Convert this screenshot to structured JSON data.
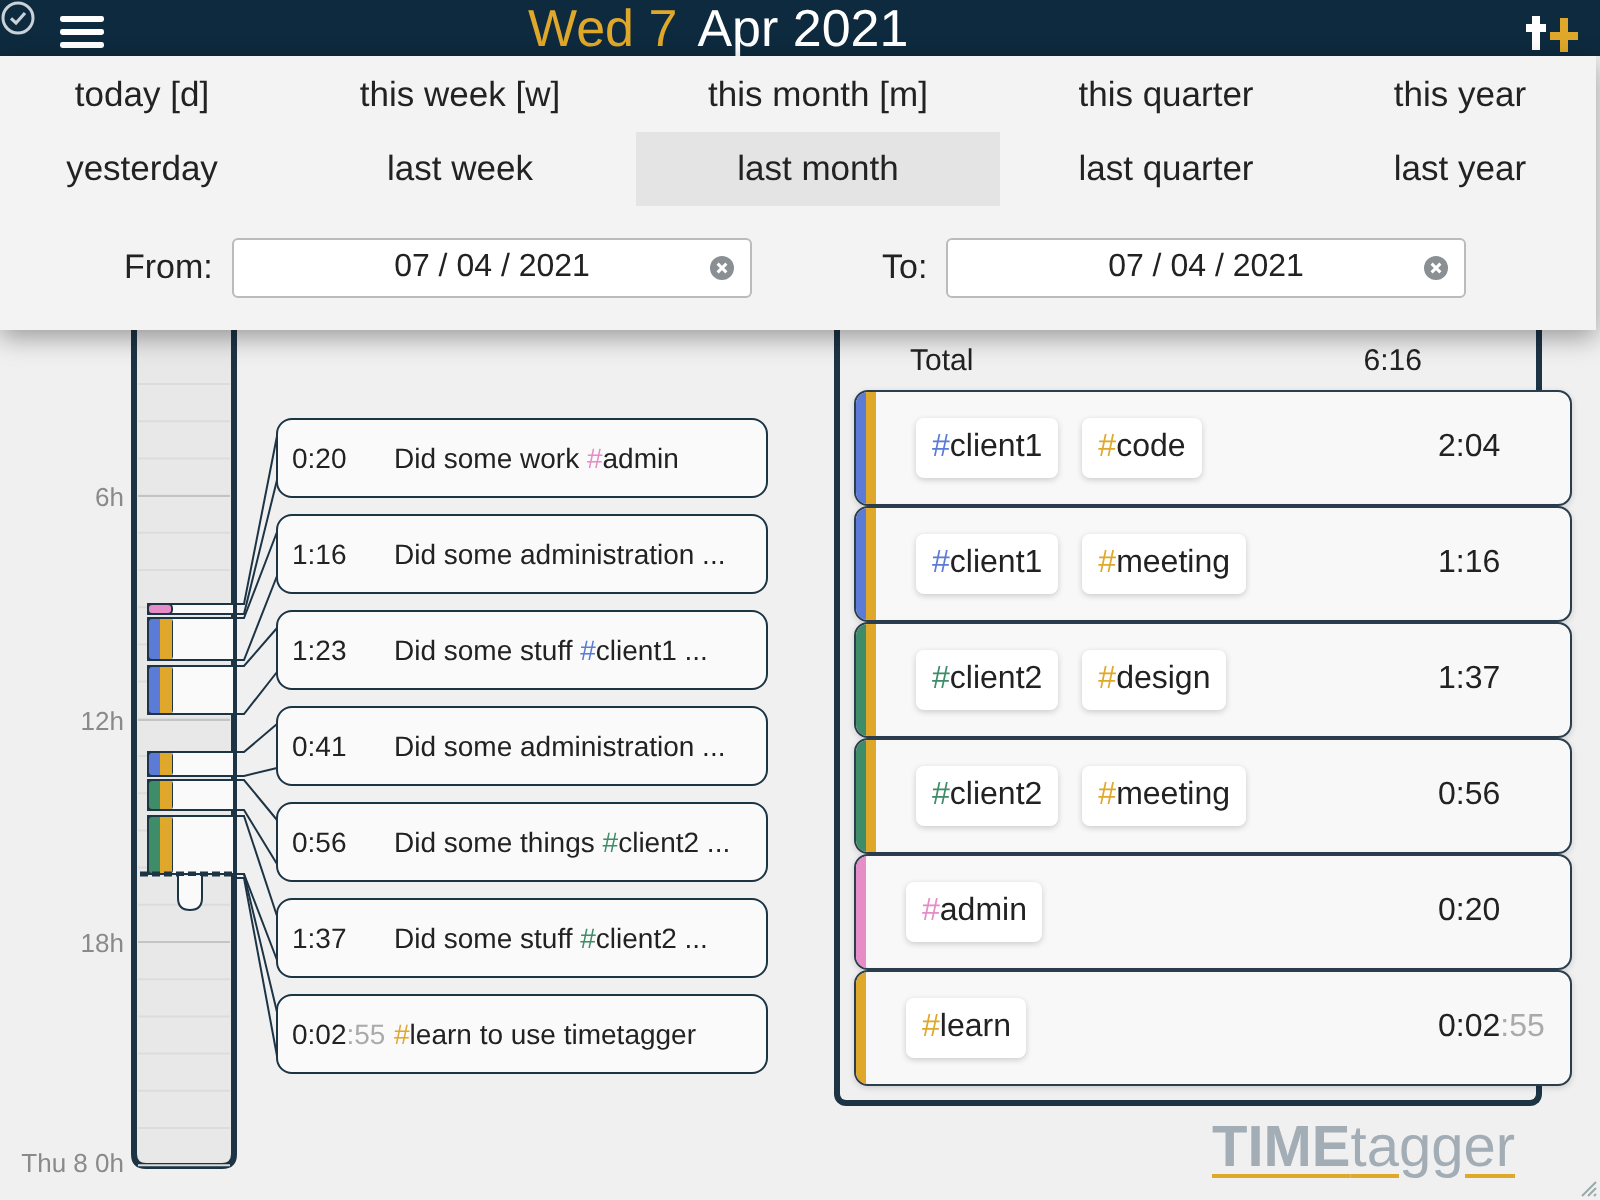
{
  "header": {
    "day": "Wed 7",
    "month": "Apr 2021"
  },
  "periods": [
    {
      "label": "today [d]",
      "selected": false
    },
    {
      "label": "this week [w]",
      "selected": false
    },
    {
      "label": "this month [m]",
      "selected": false
    },
    {
      "label": "this quarter",
      "selected": false
    },
    {
      "label": "this year",
      "selected": false
    },
    {
      "label": "yesterday",
      "selected": false
    },
    {
      "label": "last week",
      "selected": false
    },
    {
      "label": "last month",
      "selected": true
    },
    {
      "label": "last quarter",
      "selected": false
    },
    {
      "label": "last year",
      "selected": false
    }
  ],
  "range": {
    "from_label": "From:",
    "from_value": "07 / 04 / 2021",
    "to_label": "To:",
    "to_value": "07 / 04 / 2021"
  },
  "hour_labels": [
    "6h",
    "12h",
    "18h",
    "Thu 8 0h"
  ],
  "records": [
    {
      "duration": "0:20",
      "parts": [
        {
          "kind": "text",
          "text": "Did some work "
        },
        {
          "kind": "tag",
          "hash": "#",
          "name": "admin",
          "color": "#e68cc6"
        }
      ]
    },
    {
      "duration": "1:16",
      "parts": [
        {
          "kind": "text",
          "text": "Did some administration ..."
        }
      ]
    },
    {
      "duration": "1:23",
      "parts": [
        {
          "kind": "text",
          "text": "Did some stuff "
        },
        {
          "kind": "tag",
          "hash": "#",
          "name": "client1",
          "color": "#5b7bd6"
        },
        {
          "kind": "text",
          "text": " ..."
        }
      ]
    },
    {
      "duration": "0:41",
      "parts": [
        {
          "kind": "text",
          "text": "Did some administration ..."
        }
      ]
    },
    {
      "duration": "0:56",
      "parts": [
        {
          "kind": "text",
          "text": "Did some things "
        },
        {
          "kind": "tag",
          "hash": "#",
          "name": "client2",
          "color": "#3f8c68"
        },
        {
          "kind": "text",
          "text": " ..."
        }
      ]
    },
    {
      "duration": "1:37",
      "parts": [
        {
          "kind": "text",
          "text": "Did some stuff "
        },
        {
          "kind": "tag",
          "hash": "#",
          "name": "client2",
          "color": "#3f8c68"
        },
        {
          "kind": "text",
          "text": " ..."
        }
      ]
    },
    {
      "duration": "0:02",
      "seconds": ":55",
      "parts": [
        {
          "kind": "tag",
          "hash": "#",
          "name": "learn",
          "color": "#e0a82a"
        },
        {
          "kind": "text",
          "text": " to use timetagger"
        }
      ]
    }
  ],
  "summary": {
    "total_label": "Total",
    "total": "6:16",
    "rows": [
      {
        "stripes": [
          {
            "color": "#5b7bd6"
          },
          {
            "color": "#e0a82a"
          }
        ],
        "tags": [
          {
            "hash": "#",
            "name": "client1",
            "color": "#5b7bd6"
          },
          {
            "hash": "#",
            "name": "code",
            "color": "#e0a82a"
          }
        ],
        "duration": "2:04"
      },
      {
        "stripes": [
          {
            "color": "#5b7bd6"
          },
          {
            "color": "#e0a82a"
          }
        ],
        "tags": [
          {
            "hash": "#",
            "name": "client1",
            "color": "#5b7bd6"
          },
          {
            "hash": "#",
            "name": "meeting",
            "color": "#e0a82a"
          }
        ],
        "duration": "1:16"
      },
      {
        "stripes": [
          {
            "color": "#3f8c68"
          },
          {
            "color": "#e0a82a"
          }
        ],
        "tags": [
          {
            "hash": "#",
            "name": "client2",
            "color": "#3f8c68"
          },
          {
            "hash": "#",
            "name": "design",
            "color": "#e0a82a"
          }
        ],
        "duration": "1:37"
      },
      {
        "stripes": [
          {
            "color": "#3f8c68"
          },
          {
            "color": "#e0a82a"
          }
        ],
        "tags": [
          {
            "hash": "#",
            "name": "client2",
            "color": "#3f8c68"
          },
          {
            "hash": "#",
            "name": "meeting",
            "color": "#e0a82a"
          }
        ],
        "duration": "0:56"
      },
      {
        "stripes": [
          {
            "color": "#e68cc6"
          }
        ],
        "tags": [
          {
            "hash": "#",
            "name": "admin",
            "color": "#e68cc6"
          }
        ],
        "duration": "0:20"
      },
      {
        "stripes": [
          {
            "color": "#e0a82a"
          }
        ],
        "tags": [
          {
            "hash": "#",
            "name": "learn",
            "color": "#e0a82a"
          }
        ],
        "duration": "0:02",
        "seconds": ":55"
      }
    ]
  },
  "logo": {
    "bold": "TIME",
    "light": "tagger"
  }
}
